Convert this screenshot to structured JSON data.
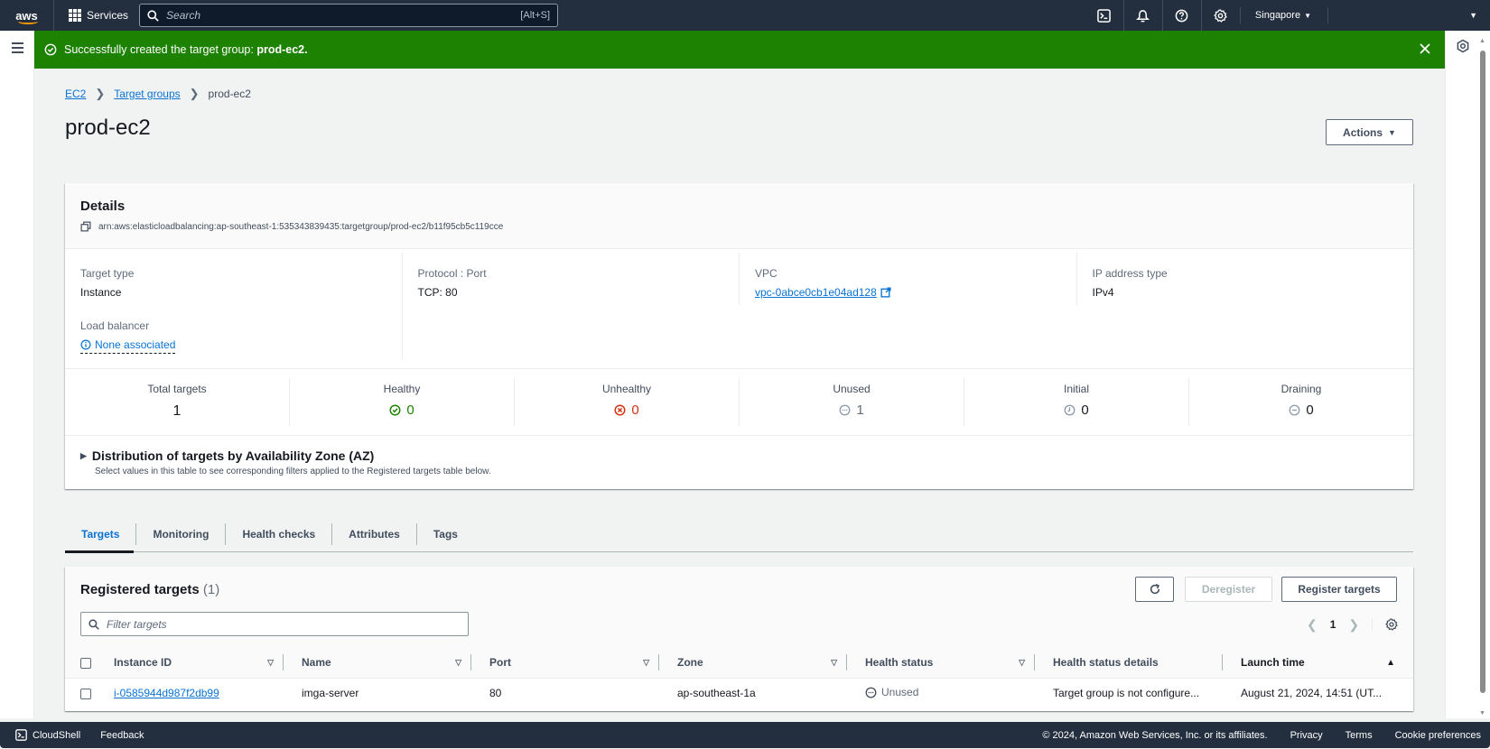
{
  "topnav": {
    "logo": "aws",
    "services_label": "Services",
    "search_placeholder": "Search",
    "search_shortcut": "[Alt+S]",
    "icons": [
      "cloudshell-icon",
      "bell-icon",
      "help-icon",
      "settings-icon"
    ],
    "region": "Singapore"
  },
  "flash": {
    "type": "success",
    "message_prefix": "Successfully created the target group: ",
    "message_bold": "prod-ec2.",
    "color": "#1d8102"
  },
  "breadcrumb": [
    {
      "label": "EC2",
      "link": true
    },
    {
      "label": "Target groups",
      "link": true
    },
    {
      "label": "prod-ec2",
      "link": false
    }
  ],
  "page": {
    "title": "prod-ec2",
    "actions_label": "Actions"
  },
  "details": {
    "title": "Details",
    "arn": "arn:aws:elasticloadbalancing:ap-southeast-1:535343839435:targetgroup/prod-ec2/b11f95cb5c119cce",
    "fields": {
      "target_type": {
        "label": "Target type",
        "value": "Instance"
      },
      "protocol_port": {
        "label": "Protocol : Port",
        "value": "TCP: 80"
      },
      "vpc": {
        "label": "VPC",
        "value": "vpc-0abce0cb1e04ad128"
      },
      "ip_address_type": {
        "label": "IP address type",
        "value": "IPv4"
      },
      "load_balancer": {
        "label": "Load balancer",
        "value": "None associated"
      }
    },
    "counts": [
      {
        "label": "Total targets",
        "value": "1"
      },
      {
        "label": "Healthy",
        "value": "0"
      },
      {
        "label": "Unhealthy",
        "value": "0"
      },
      {
        "label": "Unused",
        "value": "1"
      },
      {
        "label": "Initial",
        "value": "0"
      },
      {
        "label": "Draining",
        "value": "0"
      }
    ],
    "az": {
      "title": "Distribution of targets by Availability Zone (AZ)",
      "description": "Select values in this table to see corresponding filters applied to the Registered targets table below."
    }
  },
  "tabs": [
    {
      "label": "Targets",
      "active": true
    },
    {
      "label": "Monitoring"
    },
    {
      "label": "Health checks"
    },
    {
      "label": "Attributes"
    },
    {
      "label": "Tags"
    }
  ],
  "targets": {
    "title": "Registered targets",
    "count": "(1)",
    "filter_placeholder": "Filter targets",
    "deregister_label": "Deregister",
    "register_label": "Register targets",
    "page": "1",
    "columns": [
      "Instance ID",
      "Name",
      "Port",
      "Zone",
      "Health status",
      "Health status details",
      "Launch time"
    ],
    "rows": [
      {
        "instance_id": "i-0585944d987f2db99",
        "name": "imga-server",
        "port": "80",
        "zone": "ap-southeast-1a",
        "health_status": "Unused",
        "health_details": "Target group is not configure...",
        "launch_time": "August 21, 2024, 14:51 (UT..."
      }
    ]
  },
  "footer": {
    "cloudshell": "CloudShell",
    "feedback": "Feedback",
    "copyright": "© 2024, Amazon Web Services, Inc. or its affiliates.",
    "privacy": "Privacy",
    "terms": "Terms",
    "cookies": "Cookie preferences"
  }
}
